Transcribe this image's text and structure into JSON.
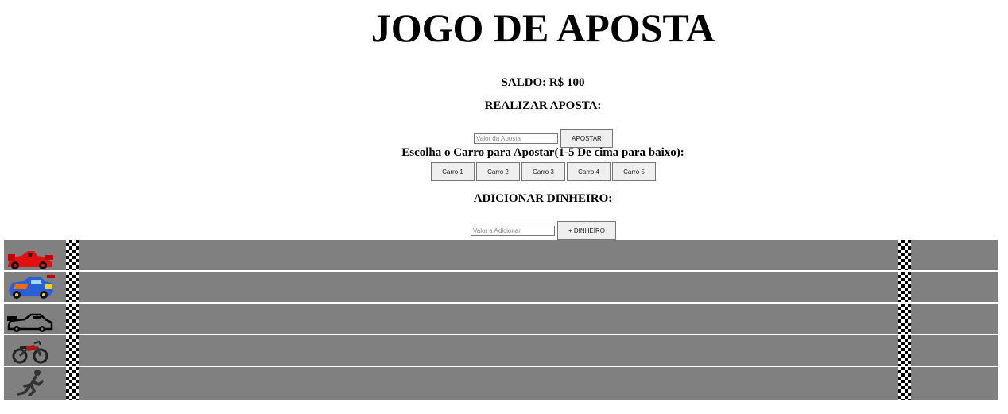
{
  "header": {
    "title": "JOGO DE APOSTA"
  },
  "balance": {
    "label": "SALDO: R$ 100"
  },
  "bet": {
    "heading": "REALIZAR APOSTA:",
    "placeholder": "Valor da Aposta",
    "button_label": "APOSTAR"
  },
  "choose": {
    "heading": "Escolha o Carro para Apostar(1-5 De cima para baixo):",
    "cars": [
      {
        "label": "Carro 1"
      },
      {
        "label": "Carro 2"
      },
      {
        "label": "Carro 3"
      },
      {
        "label": "Carro 4"
      },
      {
        "label": "Carro 5"
      }
    ]
  },
  "money": {
    "heading": "ADICIONAR DINHEIRO:",
    "placeholder": "Valor a Adicionar",
    "button_label": "+ DINHEIRO"
  },
  "track": {
    "lane_color": "#808080",
    "vehicles": [
      {
        "icon": "red-formula-car-icon"
      },
      {
        "icon": "hot-wheels-car-icon"
      },
      {
        "icon": "black-race-car-icon"
      },
      {
        "icon": "motorcycle-icon"
      },
      {
        "icon": "running-person-icon"
      }
    ]
  }
}
